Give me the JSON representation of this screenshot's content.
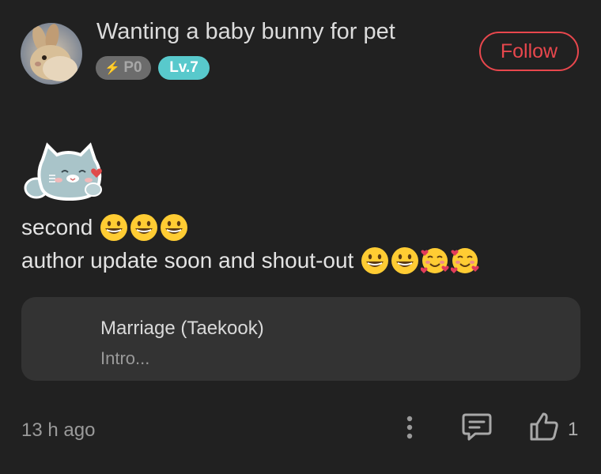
{
  "post": {
    "author": {
      "name": "Wanting a baby bunny for pet",
      "badge_p": "P0",
      "badge_level": "Lv.7",
      "avatar_icon": "bunny-avatar-icon"
    },
    "follow_label": "Follow",
    "sticker_icon": "cat-sticker-icon",
    "lines": [
      {
        "text": "second",
        "emojis": [
          "grinning",
          "grinning",
          "grinning"
        ]
      },
      {
        "text": "author update soon and shout-out",
        "emojis": [
          "grinning",
          "grinning",
          "smiling-hearts",
          "smiling-hearts"
        ]
      }
    ],
    "linked_story": {
      "title": "Marriage (Taekook)",
      "subtitle": "Intro..."
    },
    "timestamp": "13 h ago",
    "like_count": "1"
  },
  "colors": {
    "background": "#212121",
    "accent_red": "#e8474d",
    "level_badge": "#58c9cc",
    "card_bg": "#333333"
  }
}
